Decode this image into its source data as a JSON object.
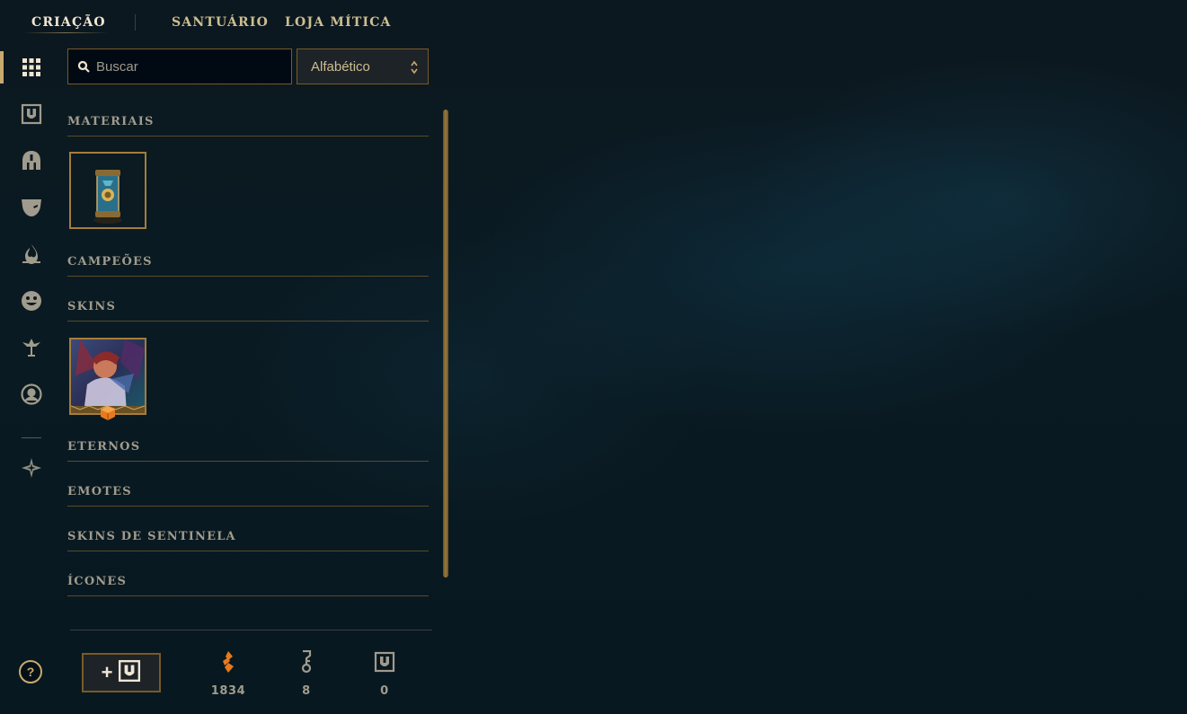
{
  "topnav": {
    "tabs": [
      {
        "label": "CRIAÇÃO",
        "active": true
      },
      {
        "label": "SANTUÁRIO",
        "active": false
      },
      {
        "label": "LOJA MÍTICA",
        "active": false
      }
    ]
  },
  "leftrail": {
    "icons": [
      "grid-icon",
      "hextech-chest-icon",
      "champion-helmet-icon",
      "skin-mask-icon",
      "eternals-flame-icon",
      "emote-face-icon",
      "ward-icon",
      "profile-icon",
      "tft-little-legend-icon"
    ],
    "active": "grid-icon",
    "help_label": "?"
  },
  "search": {
    "placeholder": "Buscar",
    "value": ""
  },
  "sort": {
    "selected": "Alfabético"
  },
  "sections": {
    "materiais": "MATERIAIS",
    "campeoes": "CAMPEÕES",
    "skins": "SKINS",
    "eternos": "ETERNOS",
    "emotes": "EMOTES",
    "skins_sentinela": "SKINS DE SENTINELA",
    "icones": "ÍCONES"
  },
  "items": {
    "materiais": [
      "mystery-capsule"
    ],
    "skins": [
      "skin-shard-artwork"
    ]
  },
  "footer": {
    "craft_button": "craft-key-button",
    "currencies": [
      {
        "icon": "orange-essence-icon",
        "value": "1834"
      },
      {
        "icon": "key-fragment-icon",
        "value": "8"
      },
      {
        "icon": "chest-icon",
        "value": "0"
      }
    ]
  },
  "colors": {
    "gold": "#c8aa6e",
    "gold_dark": "#785a28",
    "text": "#a09b8c",
    "text_light": "#f0e6d2",
    "background": "#0a1a22",
    "orange": "#e87a1e"
  }
}
